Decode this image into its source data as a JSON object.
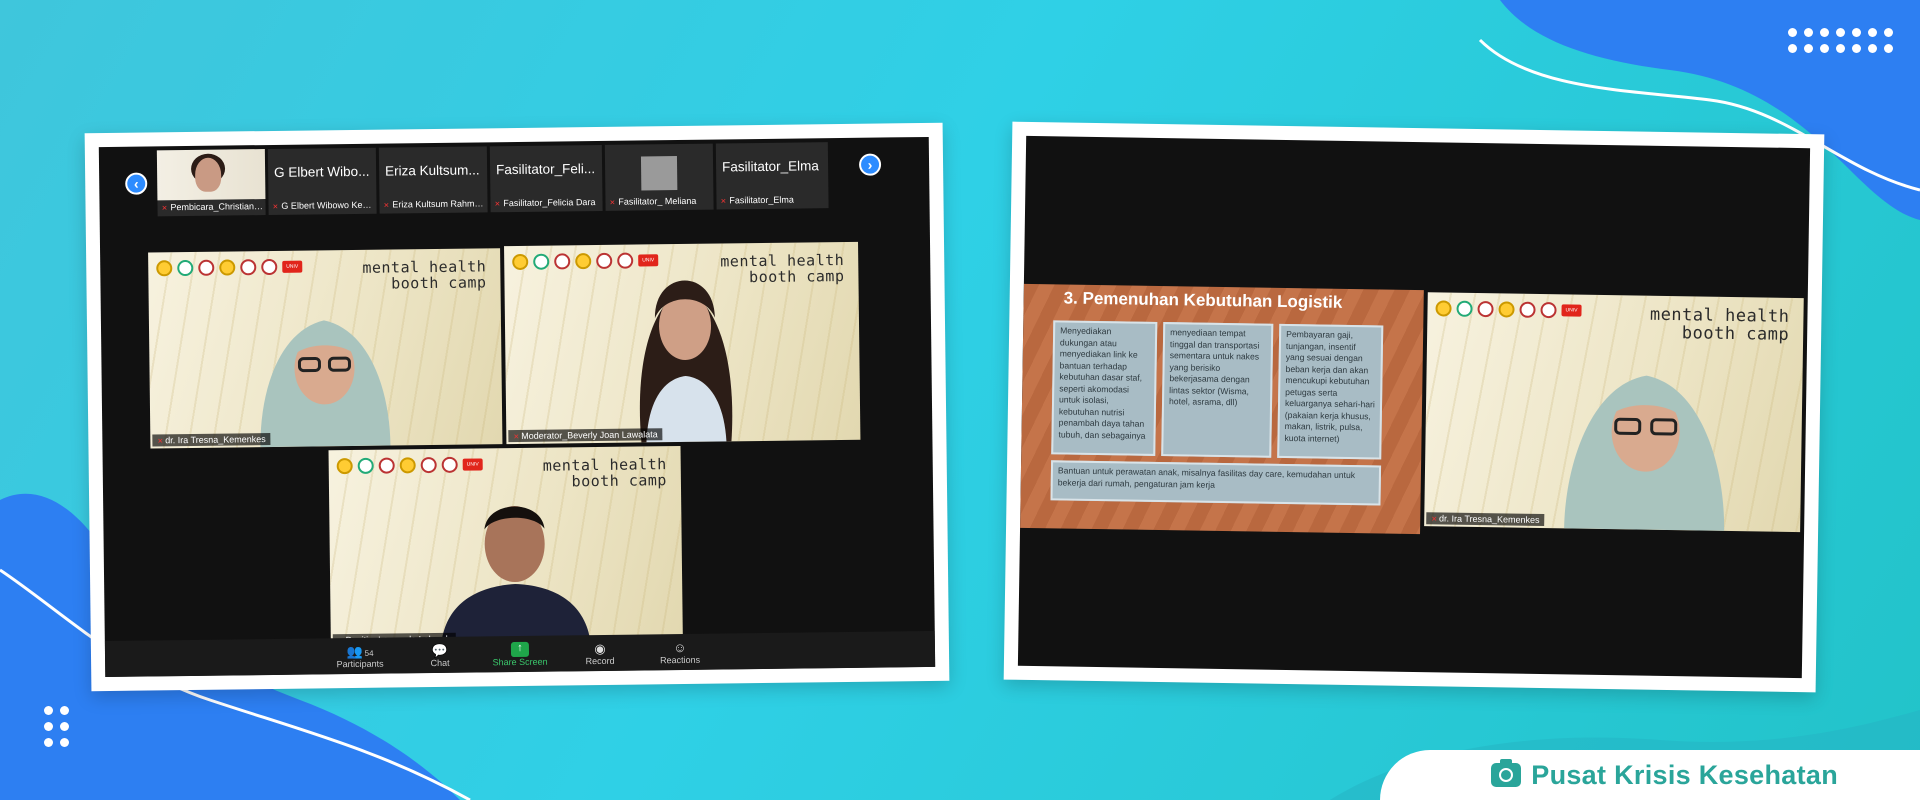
{
  "meeting": {
    "left_screen": {
      "thumbnails": [
        {
          "title": "",
          "name": "Pembicara_Christiane..."
        },
        {
          "title": "G Elbert Wibo...",
          "name": "G Elbert Wibowo Ked..."
        },
        {
          "title": "Eriza Kultsum...",
          "name": "Eriza Kultsum Rahman..."
        },
        {
          "title": "Fasilitator_Feli...",
          "name": "Fasilitator_Felicia Dara"
        },
        {
          "title": "",
          "name": "Fasilitator_ Meliana"
        },
        {
          "title": "Fasilitator_Elma",
          "name": "Fasilitator_Elma"
        }
      ],
      "prev_arrow": "‹",
      "next_arrow": "›",
      "tiles": [
        {
          "name": "dr. Ira Tresna_Kemenkes"
        },
        {
          "name": "Moderator_Beverly Joan Lawalata"
        },
        {
          "name": "Panitia_Leonardo Lalenoh"
        }
      ],
      "event_title_line1": "mental health",
      "event_title_line2": "booth camp",
      "toolbar": {
        "participants_label": "Participants",
        "participants_count": "54",
        "chat_label": "Chat",
        "share_label": "Share Screen",
        "record_label": "Record",
        "reactions_label": "Reactions"
      }
    },
    "right_screen": {
      "slide_title": "3. Pemenuhan Kebutuhan Logistik",
      "box1": "Menyediakan dukungan atau menyediakan link ke bantuan terhadap kebutuhan dasar staf, seperti akomodasi untuk isolasi, kebutuhan nutrisi penambah daya tahan tubuh, dan sebagainya",
      "box2": "menyediaan tempat tinggal dan transportasi sementara untuk nakes yang berisiko bekerjasama dengan lintas sektor (Wisma, hotel, asrama, dll)",
      "box3": "Pembayaran gaji, tunjangan, insentif yang sesuai dengan beban kerja dan akan mencukupi kebutuhan petugas serta keluarganya sehari-hari (pakaian kerja khusus, makan, listrik, pulsa, kuota internet)",
      "box4": "Bantuan untuk perawatan anak, misalnya fasilitas day care, kemudahan untuk bekerja dari rumah, pengaturan jam kerja",
      "speaker_name": "dr. Ira Tresna_Kemenkes",
      "event_title_line1": "mental health",
      "event_title_line2": "booth camp"
    }
  },
  "footer": {
    "label": "Pusat Krisis Kesehatan",
    "icon": "camera-icon",
    "color": "#2aa59a"
  }
}
